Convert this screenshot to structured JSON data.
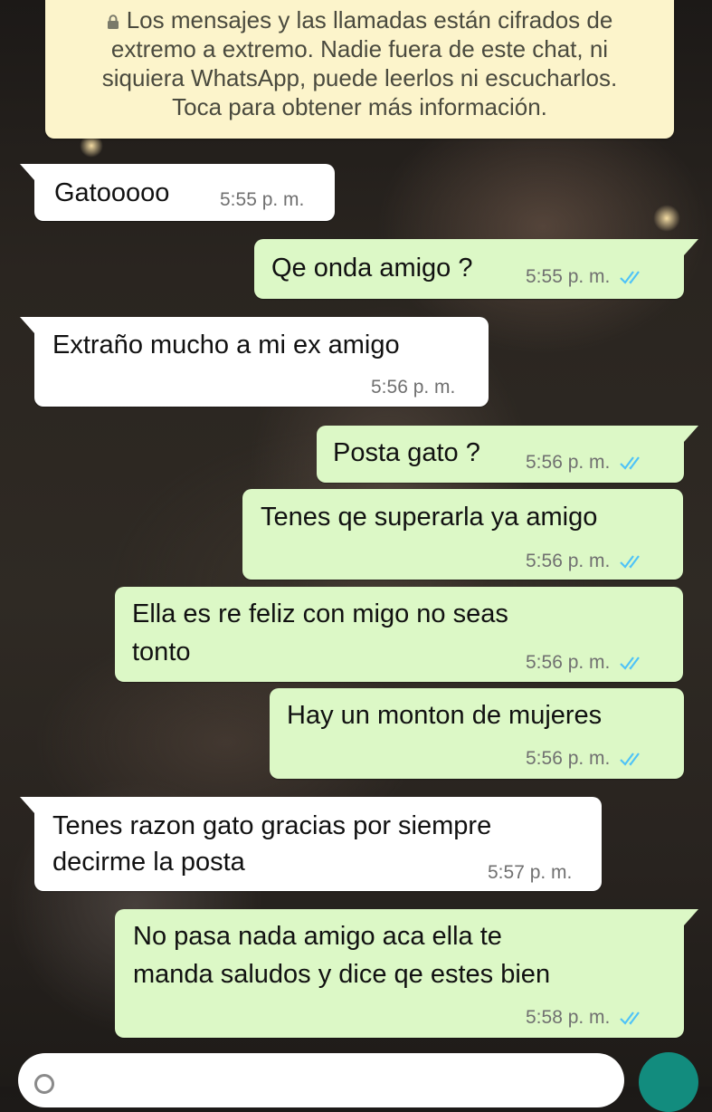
{
  "banner": {
    "lines": [
      "Los mensajes y las llamadas están cifrados de",
      "extremo a extremo. Nadie fuera de este chat, ni",
      "siquiera WhatsApp, puede leerlos ni escucharlos.",
      "Toca para obtener más información."
    ],
    "icon": "lock-icon"
  },
  "messages": [
    {
      "direction": "in",
      "lines": [
        "Gatooooo"
      ],
      "time": "5:55 p. m."
    },
    {
      "direction": "out",
      "lines": [
        "Qe onda amigo ?"
      ],
      "time": "5:55 p. m.",
      "status": "read"
    },
    {
      "direction": "in",
      "lines": [
        "Extraño mucho a mi ex amigo"
      ],
      "time": "5:56 p. m."
    },
    {
      "direction": "out",
      "lines": [
        "Posta gato ?"
      ],
      "time": "5:56 p. m.",
      "status": "read"
    },
    {
      "direction": "out",
      "lines": [
        "Tenes qe superarla ya amigo"
      ],
      "time": "5:56 p. m.",
      "status": "read"
    },
    {
      "direction": "out",
      "lines": [
        "Ella es re feliz con migo no seas",
        "tonto"
      ],
      "time": "5:56 p. m.",
      "status": "read"
    },
    {
      "direction": "out",
      "lines": [
        "Hay un monton de mujeres"
      ],
      "time": "5:56 p. m.",
      "status": "read"
    },
    {
      "direction": "in",
      "lines": [
        "Tenes razon gato gracias por siempre",
        "decirme la posta"
      ],
      "time": "5:57 p. m."
    },
    {
      "direction": "out",
      "lines": [
        "No pasa nada amigo aca ella te",
        "manda saludos y dice qe estes bien"
      ],
      "time": "5:58 p. m.",
      "status": "read"
    }
  ],
  "colors": {
    "incoming_bubble": "#ffffff",
    "outgoing_bubble": "#dcf8c6",
    "banner": "#fcf4cb",
    "read_ticks": "#4fc3f7",
    "timestamp": "#707070"
  }
}
